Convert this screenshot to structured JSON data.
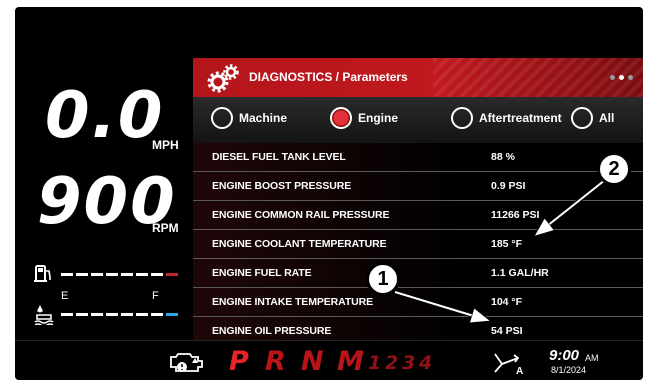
{
  "speed": {
    "value": "0.0",
    "unit": "MPH"
  },
  "rpm": {
    "value": "900",
    "unit": "RPM"
  },
  "fuel_gauge": {
    "empty_label": "E",
    "full_label": "F"
  },
  "panel": {
    "title": "DIAGNOSTICS / Parameters",
    "icon": "gears-icon"
  },
  "filters": [
    {
      "label": "Machine",
      "selected": false
    },
    {
      "label": "Engine",
      "selected": true
    },
    {
      "label": "Aftertreatment",
      "selected": false
    },
    {
      "label": "All",
      "selected": false
    }
  ],
  "parameters": [
    {
      "name": "DIESEL FUEL TANK LEVEL",
      "value": "88 %"
    },
    {
      "name": "ENGINE BOOST PRESSURE",
      "value": "0.9 PSI"
    },
    {
      "name": "ENGINE COMMON RAIL PRESSURE",
      "value": "11266 PSI"
    },
    {
      "name": "ENGINE COOLANT TEMPERATURE",
      "value": "185 °F"
    },
    {
      "name": "ENGINE FUEL RATE",
      "value": "1.1 GAL/HR"
    },
    {
      "name": "ENGINE INTAKE TEMPERATURE",
      "value": "104 °F"
    },
    {
      "name": "ENGINE OIL PRESSURE",
      "value": "54 PSI"
    }
  ],
  "gears": {
    "main": [
      "P",
      "R",
      "N",
      "M"
    ],
    "manual": [
      "1",
      "2",
      "3",
      "4"
    ],
    "active": "P"
  },
  "clock": {
    "time": "9:00",
    "ampm": "AM",
    "date": "8/1/2024"
  },
  "callouts": [
    "1",
    "2"
  ],
  "colors": {
    "accent": "#c0191f",
    "fuel_end": "#c0262c",
    "def_end": "#2aa8e6"
  }
}
